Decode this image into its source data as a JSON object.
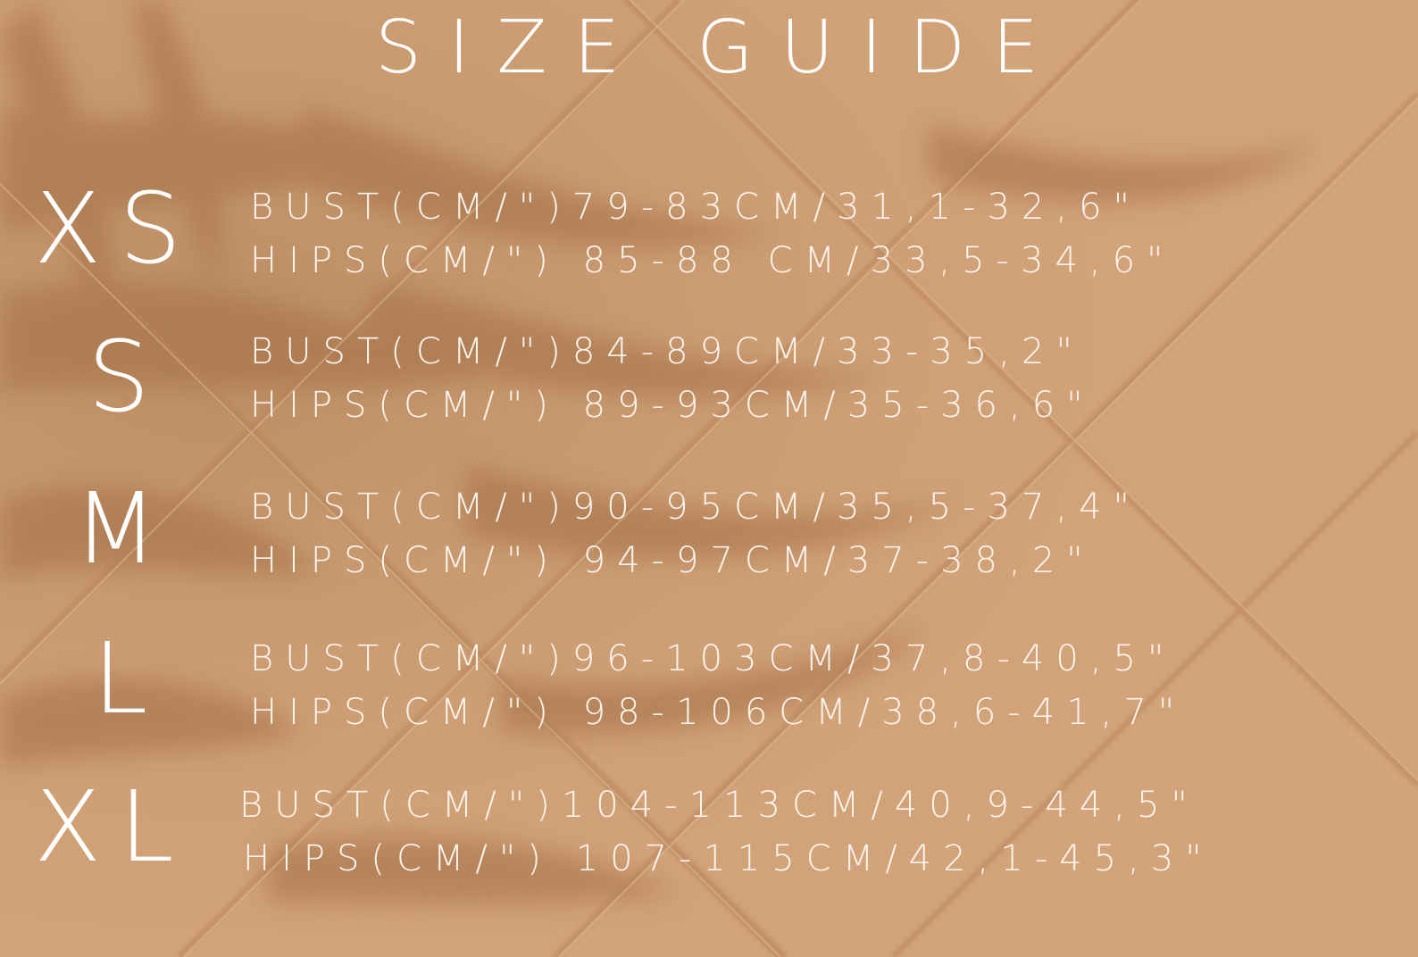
{
  "title": "SIZE GUIDE",
  "colors": {
    "background": "#d09f76",
    "text": "#ffffff"
  },
  "sizes": [
    {
      "label": "XS",
      "bust": "BUST(CM/\")79-83CM/31,1-32,6\"",
      "hips": "HIPS(CM/\") 85-88 CM/33,5-34,6\""
    },
    {
      "label": "S",
      "bust": "BUST(CM/\")84-89CM/33-35,2\"",
      "hips": "HIPS(CM/\") 89-93CM/35-36,6\""
    },
    {
      "label": "M",
      "bust": "BUST(CM/\")90-95CM/35,5-37,4\"",
      "hips": "HIPS(CM/\") 94-97CM/37-38,2\""
    },
    {
      "label": "L",
      "bust": "BUST(CM/\")96-103CM/37,8-40,5\"",
      "hips": "HIPS(CM/\") 98-106CM/38,6-41,7\""
    },
    {
      "label": "XL",
      "bust": "BUST(CM/\")104-113CM/40,9-44,5\"",
      "hips": "HIPS(CM/\") 107-115CM/42,1-45,3\""
    }
  ]
}
